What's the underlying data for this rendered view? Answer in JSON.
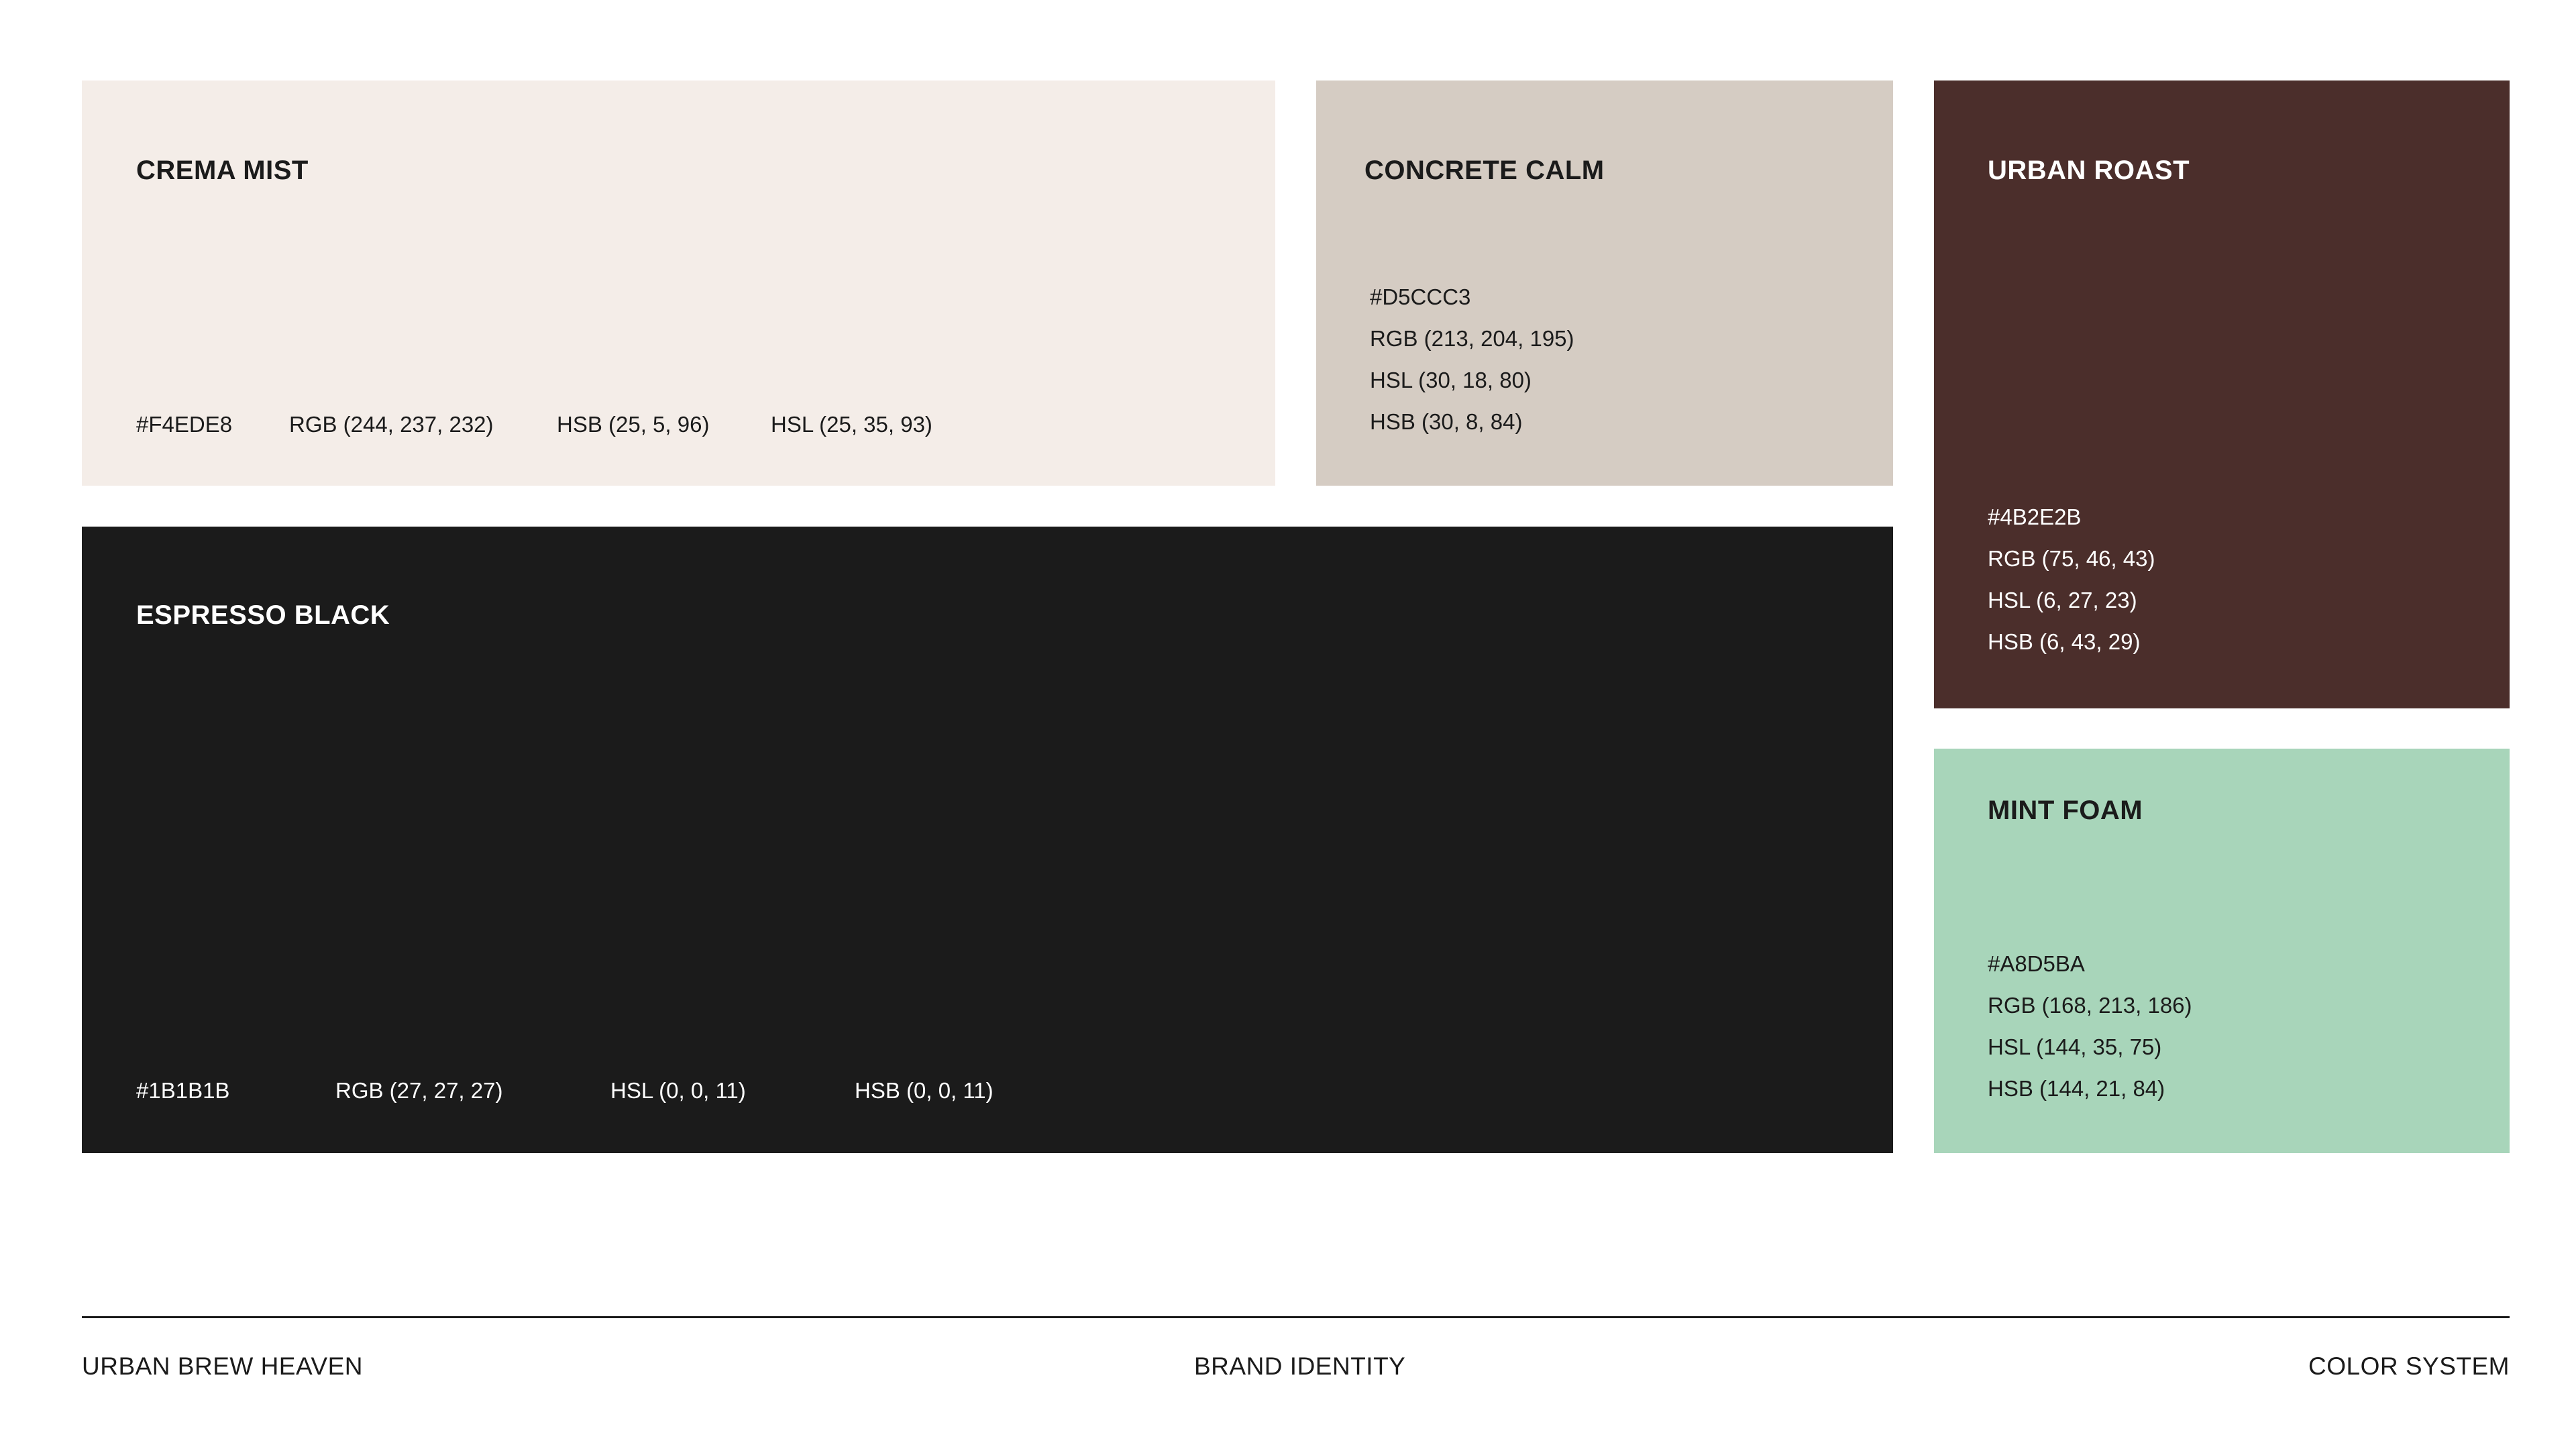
{
  "swatches": {
    "crema": {
      "name": "CREMA MIST",
      "color": "#F4EDE8",
      "hex": "#F4EDE8",
      "rgb": "RGB (244, 237, 232)",
      "hsb": "HSB (25, 5, 96)",
      "hsl": "HSL (25, 35, 93)"
    },
    "concrete": {
      "name": "CONCRETE CALM",
      "color": "#D5CCC3",
      "hex": "#D5CCC3",
      "rgb": "RGB (213, 204, 195)",
      "hsl": "HSL (30, 18, 80)",
      "hsb": "HSB (30, 8, 84)"
    },
    "roast": {
      "name": "URBAN ROAST",
      "color": "#4B2E2B",
      "hex": "#4B2E2B",
      "rgb": "RGB (75, 46, 43)",
      "hsl": "HSL (6, 27, 23)",
      "hsb": "HSB (6, 43, 29)"
    },
    "espresso": {
      "name": "ESPRESSO BLACK",
      "color": "#1B1B1B",
      "hex": "#1B1B1B",
      "rgb": "RGB (27, 27, 27)",
      "hsl": "HSL (0, 0, 11)",
      "hsb": "HSB (0, 0, 11)"
    },
    "mint": {
      "name": "MINT FOAM",
      "color": "#A8D5BA",
      "hex": "#A8D5BA",
      "rgb": "RGB (168, 213, 186)",
      "hsl": "HSL (144, 35, 75)",
      "hsb": "HSB (144, 21, 84)"
    }
  },
  "footer": {
    "left": "URBAN BREW HEAVEN",
    "center": "BRAND IDENTITY",
    "right": "COLOR SYSTEM"
  }
}
